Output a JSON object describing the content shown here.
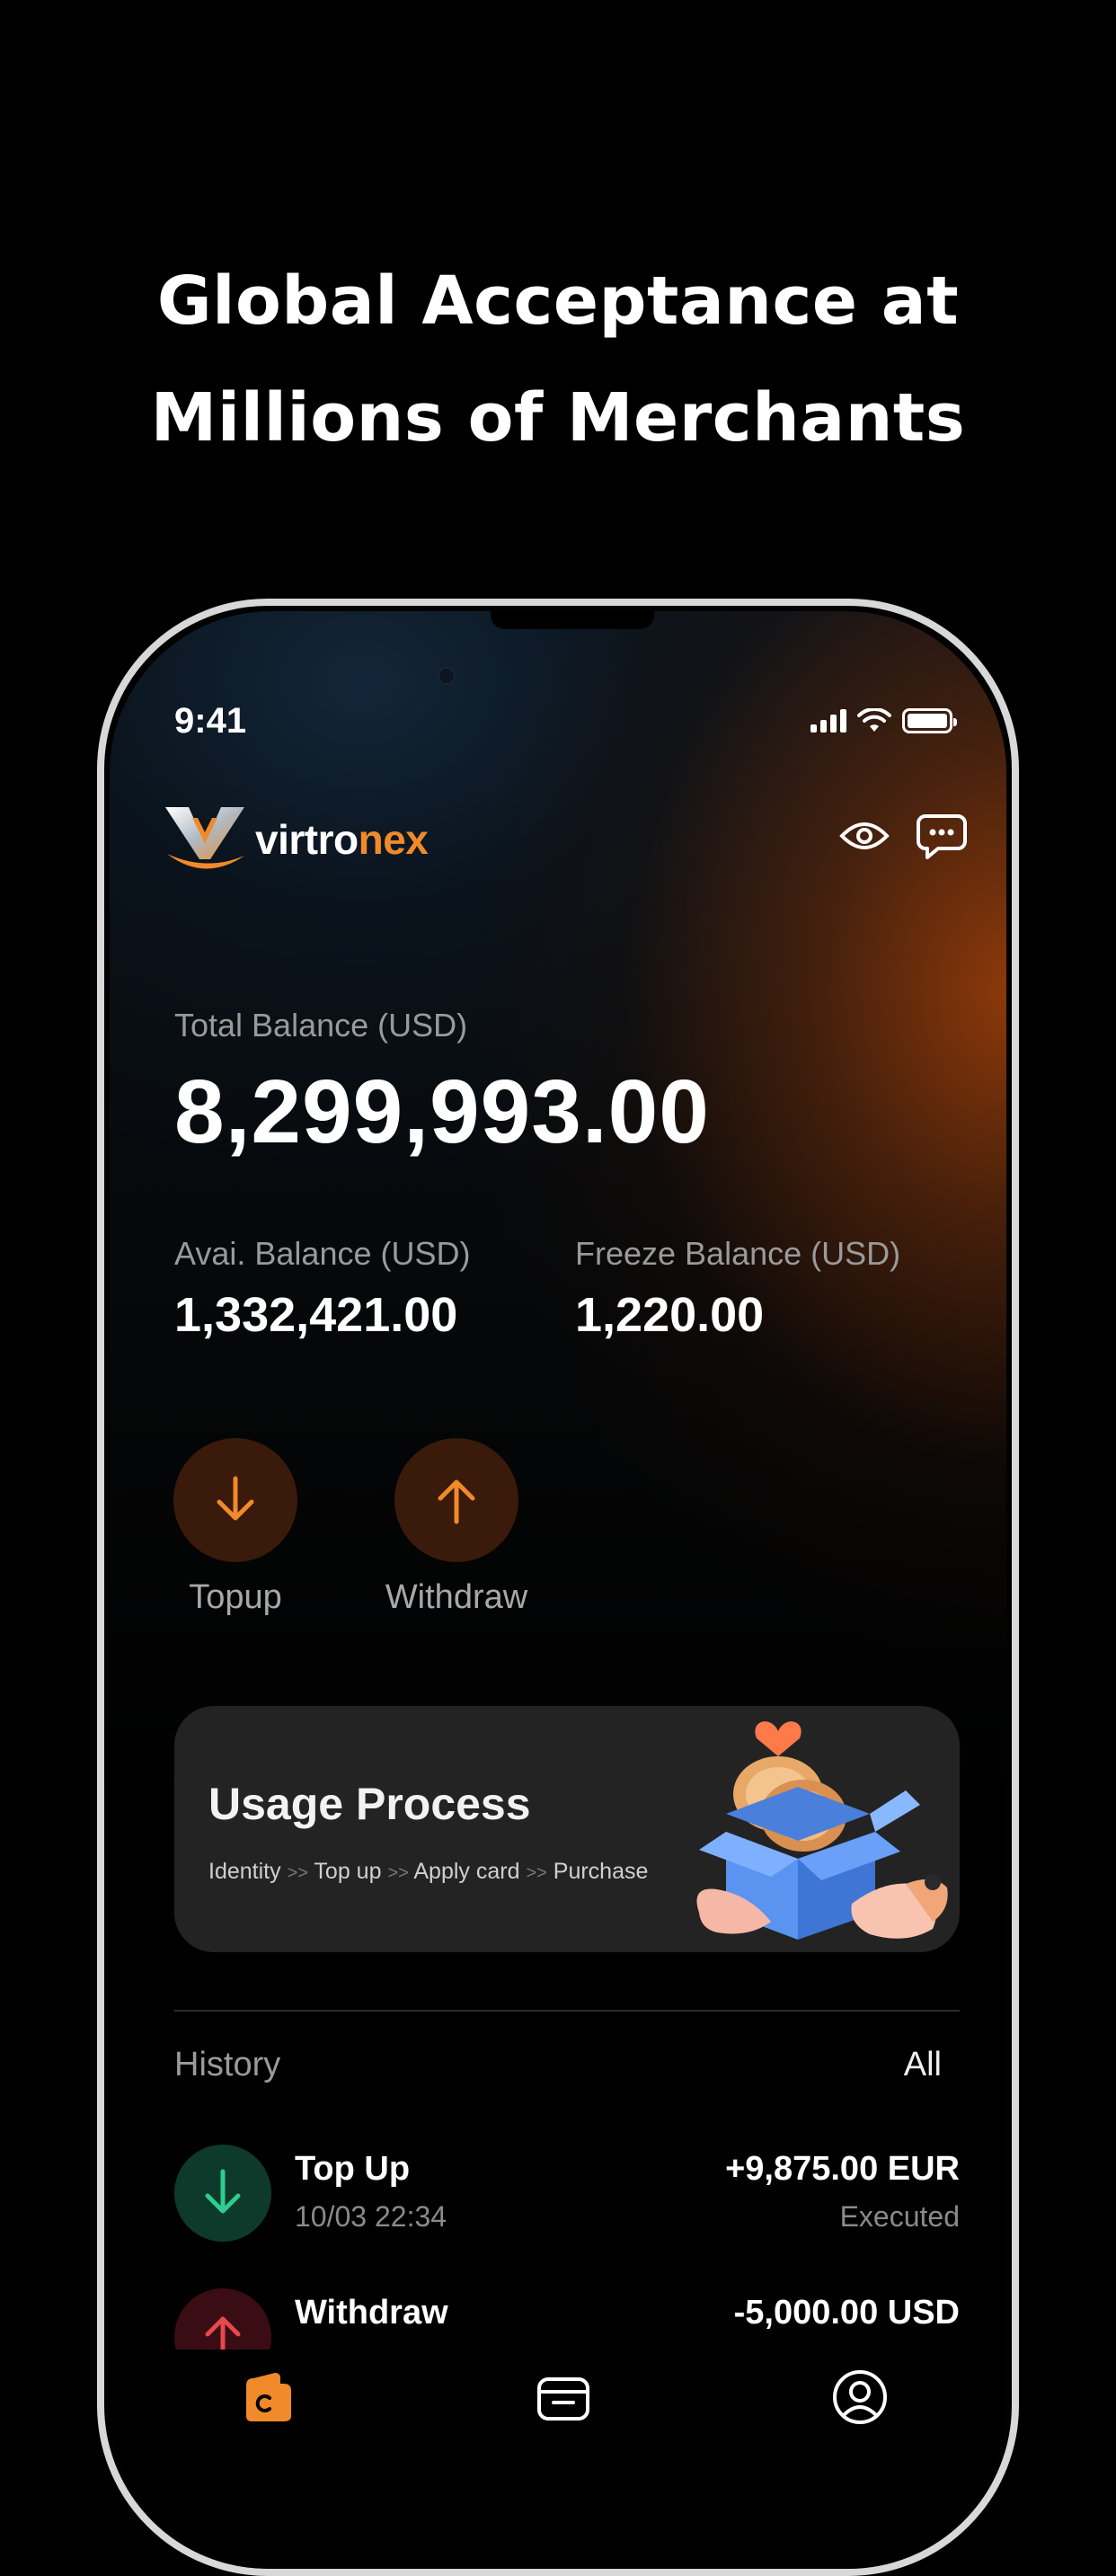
{
  "headline": {
    "line1": "Global Acceptance at",
    "line2": "Millions of Merchants"
  },
  "status_bar": {
    "time": "9:41"
  },
  "brand": {
    "name_part1": "virtro",
    "name_part2": "nex",
    "accent": "#f08a2a"
  },
  "balance": {
    "total_label": "Total Balance (USD)",
    "total_value": "8,299,993.00",
    "available_label": "Avai. Balance (USD)",
    "available_value": "1,332,421.00",
    "freeze_label": "Freeze Balance (USD)",
    "freeze_value": "1,220.00"
  },
  "actions": {
    "topup_label": "Topup",
    "withdraw_label": "Withdraw"
  },
  "usage": {
    "title": "Usage Process",
    "steps": [
      "Identity",
      "Top up",
      "Apply card",
      "Purchase"
    ],
    "separator": ">>"
  },
  "history": {
    "label": "History",
    "all_label": "All",
    "items": [
      {
        "name": "Top Up",
        "date": "10/03 22:34",
        "amount": "+9,875.00 EUR",
        "status": "Executed",
        "color": "#2ecc8f"
      },
      {
        "name": "Withdraw",
        "date": "",
        "amount": "-5,000.00 USD",
        "status": "",
        "color": "#e5484d"
      }
    ]
  },
  "tabs": [
    "wallet-icon",
    "card-icon",
    "profile-icon"
  ],
  "colors": {
    "accent": "#f08a2a",
    "card_bg": "#232323"
  }
}
